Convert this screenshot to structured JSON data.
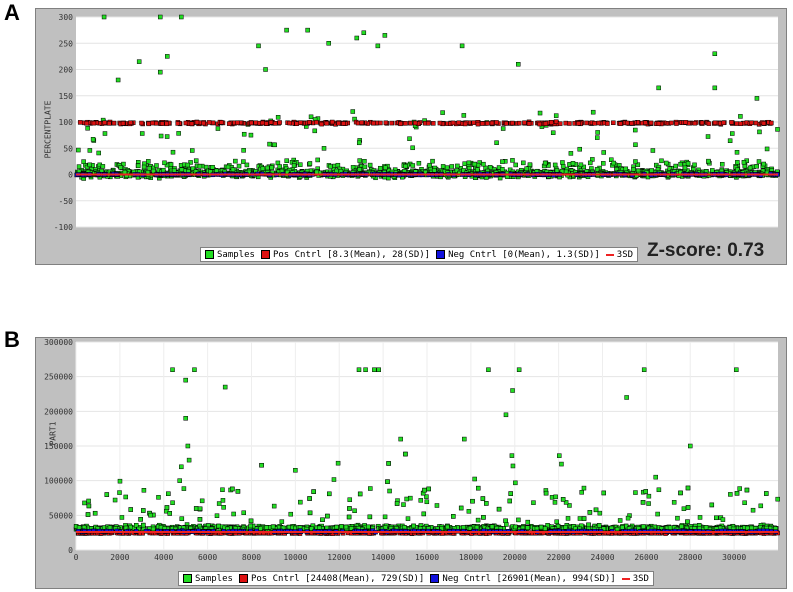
{
  "panels": {
    "a": {
      "letter": "A"
    },
    "b": {
      "letter": "B"
    }
  },
  "zscore": "Z-score: 0.73",
  "colors": {
    "samples": "#22dd22",
    "pos": "#dd1111",
    "neg": "#1111dd",
    "sd3": "#ee2222",
    "plot_bg": "#ffffff",
    "frame": "#c0c0c0"
  },
  "chart_data": [
    {
      "id": "A",
      "type": "scatter",
      "ylabel": "PERCENTPLATE",
      "xlabel": "",
      "ylim": [
        -100,
        300
      ],
      "y_ticks": [
        -100,
        -50,
        0,
        50,
        100,
        150,
        200,
        250,
        300
      ],
      "legend": {
        "placement": "bottom-center",
        "items": [
          {
            "kind": "box",
            "color": "#22dd22",
            "label": "Samples"
          },
          {
            "kind": "box",
            "color": "#dd1111",
            "label": "Pos Cntrl [8.3(Mean), 28(SD)]"
          },
          {
            "kind": "box",
            "color": "#1111dd",
            "label": "Neg Cntrl [0(Mean), 1.3(SD)]"
          },
          {
            "kind": "line",
            "color": "#ee2222",
            "label": "3SD"
          }
        ]
      },
      "series": [
        {
          "name": "Samples",
          "distribution": "dense band near 0 (mostly -40 to 60) with outliers up to 300"
        },
        {
          "name": "Pos Cntrl",
          "distribution": "band near 100 (approx 90-110)"
        },
        {
          "name": "Neg Cntrl",
          "distribution": "band near 0 (approx -5 to 5)"
        }
      ],
      "reference_lines": [
        {
          "name": "3SD",
          "y": 0
        }
      ],
      "highlighted_outliers": [
        [
          0.04,
          305
        ],
        [
          0.12,
          310
        ],
        [
          0.15,
          300
        ],
        [
          0.3,
          275
        ],
        [
          0.36,
          250
        ],
        [
          0.41,
          270
        ],
        [
          0.44,
          265
        ],
        [
          0.55,
          245
        ],
        [
          0.91,
          230
        ],
        [
          0.09,
          215
        ],
        [
          0.13,
          225
        ],
        [
          0.33,
          275
        ],
        [
          0.4,
          260
        ],
        [
          0.63,
          210
        ],
        [
          0.26,
          245
        ],
        [
          0.97,
          145
        ],
        [
          0.91,
          165
        ],
        [
          0.83,
          165
        ],
        [
          0.06,
          180
        ],
        [
          0.12,
          195
        ],
        [
          0.43,
          245
        ],
        [
          0.27,
          200
        ]
      ]
    },
    {
      "id": "B",
      "type": "scatter",
      "ylabel": "PART1",
      "xlabel": "",
      "xlim": [
        0,
        32000
      ],
      "ylim": [
        0,
        300000
      ],
      "x_ticks": [
        0,
        2000,
        4000,
        6000,
        8000,
        10000,
        12000,
        14000,
        16000,
        18000,
        20000,
        22000,
        24000,
        26000,
        28000,
        30000
      ],
      "y_ticks": [
        0,
        50000,
        100000,
        150000,
        200000,
        250000,
        300000
      ],
      "legend": {
        "placement": "bottom-center",
        "items": [
          {
            "kind": "box",
            "color": "#22dd22",
            "label": "Samples"
          },
          {
            "kind": "box",
            "color": "#dd1111",
            "label": "Pos Cntrl [24408(Mean), 729(SD)]"
          },
          {
            "kind": "box",
            "color": "#1111dd",
            "label": "Neg Cntrl [26901(Mean), 994(SD)]"
          },
          {
            "kind": "line",
            "color": "#ee2222",
            "label": "3SD"
          }
        ]
      },
      "series": [
        {
          "name": "Samples",
          "distribution": "dense band near 25000-45000 with outliers up to 260000"
        },
        {
          "name": "Pos Cntrl",
          "distribution": "band near 24408"
        },
        {
          "name": "Neg Cntrl",
          "distribution": "band near 26901"
        }
      ],
      "reference_lines": [
        {
          "name": "3SD",
          "y": 26000
        }
      ],
      "highlighted_outliers": [
        [
          4400,
          260000
        ],
        [
          5000,
          245000
        ],
        [
          5400,
          260000
        ],
        [
          6800,
          235000
        ],
        [
          12900,
          260000
        ],
        [
          13200,
          260000
        ],
        [
          13600,
          260000
        ],
        [
          13800,
          260000
        ],
        [
          18800,
          260000
        ],
        [
          20200,
          260000
        ],
        [
          19900,
          230000
        ],
        [
          19600,
          195000
        ],
        [
          25900,
          260000
        ],
        [
          25100,
          220000
        ],
        [
          30100,
          260000
        ],
        [
          5000,
          190000
        ],
        [
          5100,
          150000
        ],
        [
          28000,
          150000
        ],
        [
          17700,
          160000
        ],
        [
          14800,
          160000
        ],
        [
          4800,
          120000
        ],
        [
          10000,
          115000
        ]
      ]
    }
  ]
}
